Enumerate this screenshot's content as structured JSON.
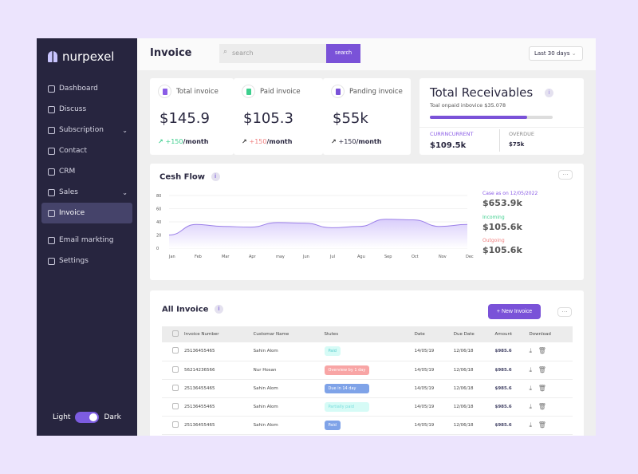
{
  "brand": "nurpexel",
  "sidebar": {
    "items": [
      {
        "label": "Dashboard",
        "icon": "grid-icon"
      },
      {
        "label": "Discuss",
        "icon": "chat-icon"
      },
      {
        "label": "Subscription",
        "icon": "box-icon",
        "chevron": true
      },
      {
        "label": "Contact",
        "icon": "contact-icon"
      },
      {
        "label": "CRM",
        "icon": "globe-icon"
      },
      {
        "label": "Sales",
        "icon": "bag-icon",
        "chevron": true
      },
      {
        "label": "Invoice",
        "icon": "document-icon",
        "active": true
      },
      {
        "label": "Email markting",
        "icon": "mail-icon"
      },
      {
        "label": "Settings",
        "icon": "gear-icon"
      }
    ],
    "theme": {
      "light": "Light",
      "dark": "Dark",
      "selected": "Dark"
    }
  },
  "header": {
    "title": "Invoice",
    "search_placeholder": "search",
    "search_button": "search",
    "range": "Last 30 days"
  },
  "stats": [
    {
      "label": "Total invoice",
      "value": "$145.9",
      "delta": "+150",
      "unit": "/month",
      "delta_color": "#3ecf8e",
      "icon_color": "#8a5ce6"
    },
    {
      "label": "Paid invoice",
      "value": "$105.3",
      "delta": "+150",
      "unit": "/month",
      "delta_color": "#f08080",
      "icon_color": "#3ecf8e"
    },
    {
      "label": "Panding invoice",
      "value": "$55k",
      "delta": "+150",
      "unit": "/month",
      "delta_color": "#2a2840",
      "icon_color": "#7a52d8"
    }
  ],
  "receivables": {
    "title": "Total Receivables",
    "subtitle": "Toal onpaid inbovice $35.078",
    "progress": 0.79,
    "current_label": "CURRNCURRENT",
    "current_value": "$109.5k",
    "overdue_label": "OVERDUE",
    "overdue_value": "$75k"
  },
  "cashflow": {
    "title": "Cesh Flow",
    "case_label": "Case as on 12/05/2022",
    "case_value": "$653.9k",
    "incoming_label": "Incoming",
    "incoming_value": "$105.6k",
    "outgoing_label": "Outgoing",
    "outgoing_value": "$105.6k"
  },
  "chart_data": {
    "type": "area",
    "categories": [
      "Jan",
      "Feb",
      "Mar",
      "Apr",
      "may",
      "Jun",
      "Jul",
      "Agu",
      "Sep",
      "Oct",
      "Nov",
      "Dec"
    ],
    "values": [
      20,
      36,
      33,
      32,
      39,
      38,
      31,
      33,
      44,
      43,
      33,
      36
    ],
    "ylim": [
      0,
      80
    ],
    "yticks": [
      0,
      20,
      40,
      60,
      80
    ],
    "color": "#9b7fe8",
    "grid": true
  },
  "invoices": {
    "title": "All Invoice",
    "new_button": "New Invoice",
    "columns": [
      "Invoice Number",
      "Customar Name",
      "Stutes",
      "Date",
      "Due Date",
      "Amount",
      "Download"
    ],
    "rows": [
      [
        "25136455465",
        "Sahin Alom",
        "Paid",
        "14/05/19",
        "12/06/18",
        "$985.6"
      ],
      [
        "56214236566",
        "Nur Hosan",
        "Overview by 1 day",
        "14/05/19",
        "12/06/18",
        "$985.6"
      ],
      [
        "25136455465",
        "Sahin Alom",
        "Due in 14 day",
        "14/05/19",
        "12/06/18",
        "$985.6"
      ],
      [
        "25136455465",
        "Sahin Alom",
        "Partially paid",
        "14/05/19",
        "12/06/18",
        "$985.6"
      ],
      [
        "25136455465",
        "Sahin Alom",
        "Paid",
        "14/05/19",
        "12/06/18",
        "$985.6"
      ]
    ],
    "status_colors": [
      {
        "bg": "#d6fbf6",
        "fg": "#5cc"
      },
      {
        "bg": "#f8a5a5",
        "fg": "#fff"
      },
      {
        "bg": "#7fa3e8",
        "fg": "#fff"
      },
      {
        "bg": "#d6fbf6",
        "fg": "#7dd"
      },
      {
        "bg": "#7fa3e8",
        "fg": "#fff"
      }
    ]
  }
}
